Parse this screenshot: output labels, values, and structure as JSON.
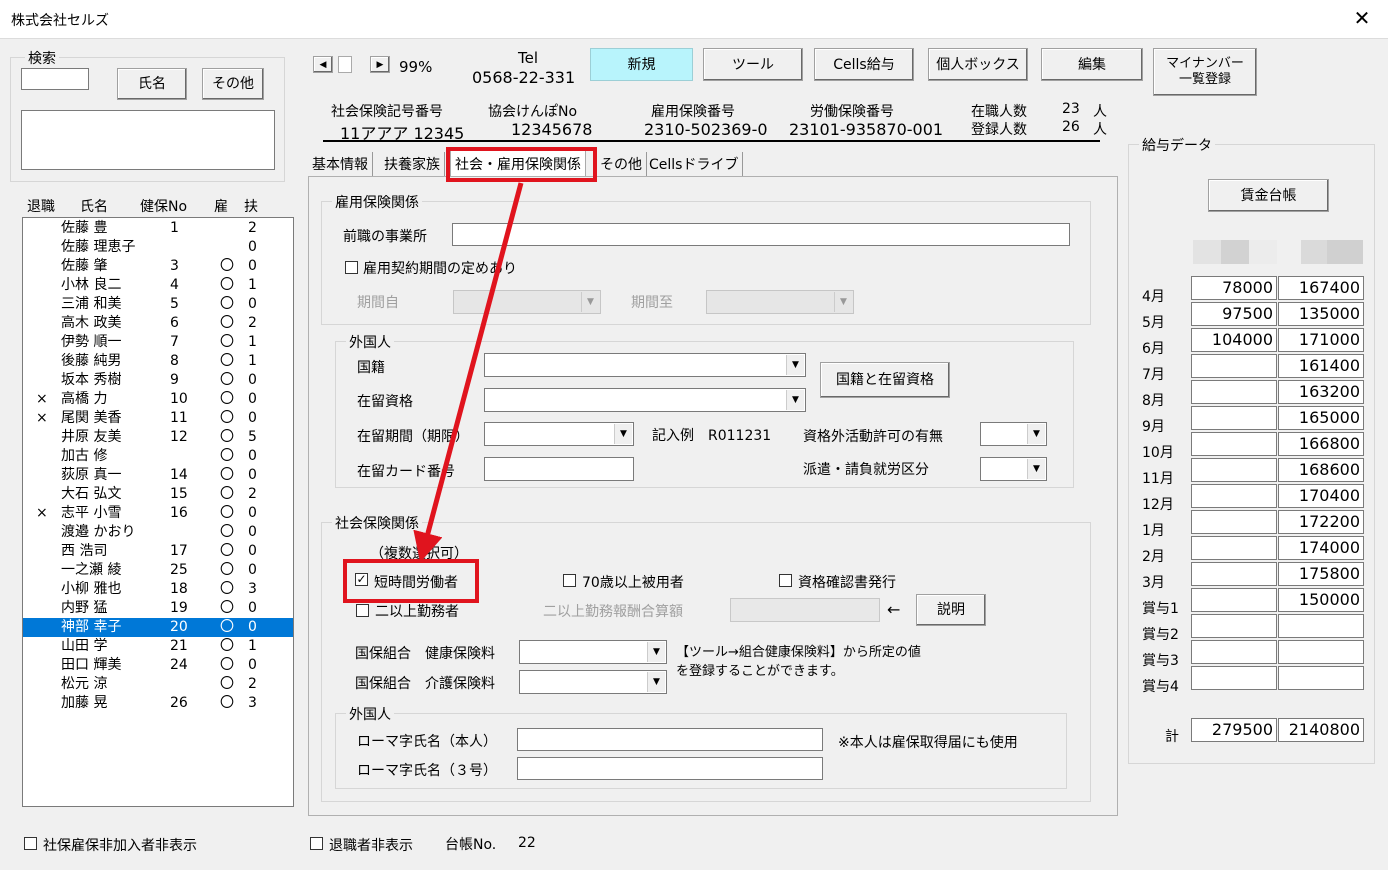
{
  "window": {
    "title": "株式会社セルズ",
    "close": "✕"
  },
  "search": {
    "legend": "検索",
    "name_btn": "氏名",
    "other_btn": "その他",
    "input_value": ""
  },
  "list": {
    "headers": {
      "retired": "退職",
      "name": "氏名",
      "kenpo": "健保No",
      "koyo": "雇",
      "fuyo": "扶"
    },
    "rows": [
      {
        "mark": "",
        "name": "佐藤 豊",
        "no": "1",
        "koyo": "",
        "fuyo": "2"
      },
      {
        "mark": "",
        "name": "佐藤 理恵子",
        "no": "",
        "koyo": "",
        "fuyo": "0"
      },
      {
        "mark": "",
        "name": "佐藤 肇",
        "no": "3",
        "koyo": "〇",
        "fuyo": "0"
      },
      {
        "mark": "",
        "name": "小林 良二",
        "no": "4",
        "koyo": "〇",
        "fuyo": "1"
      },
      {
        "mark": "",
        "name": "三浦 和美",
        "no": "5",
        "koyo": "〇",
        "fuyo": "0"
      },
      {
        "mark": "",
        "name": "高木 政美",
        "no": "6",
        "koyo": "〇",
        "fuyo": "2"
      },
      {
        "mark": "",
        "name": "伊勢 順一",
        "no": "7",
        "koyo": "〇",
        "fuyo": "1"
      },
      {
        "mark": "",
        "name": "後藤 純男",
        "no": "8",
        "koyo": "〇",
        "fuyo": "1"
      },
      {
        "mark": "",
        "name": "坂本 秀樹",
        "no": "9",
        "koyo": "〇",
        "fuyo": "0"
      },
      {
        "mark": "×",
        "name": "高橋 力",
        "no": "10",
        "koyo": "〇",
        "fuyo": "0"
      },
      {
        "mark": "×",
        "name": "尾関 美香",
        "no": "11",
        "koyo": "〇",
        "fuyo": "0"
      },
      {
        "mark": "",
        "name": "井原 友美",
        "no": "12",
        "koyo": "〇",
        "fuyo": "5"
      },
      {
        "mark": "",
        "name": "加古 修",
        "no": "",
        "koyo": "〇",
        "fuyo": "0"
      },
      {
        "mark": "",
        "name": "荻原 真一",
        "no": "14",
        "koyo": "〇",
        "fuyo": "0"
      },
      {
        "mark": "",
        "name": "大石 弘文",
        "no": "15",
        "koyo": "〇",
        "fuyo": "2"
      },
      {
        "mark": "×",
        "name": "志平 小雪",
        "no": "16",
        "koyo": "〇",
        "fuyo": "0"
      },
      {
        "mark": "",
        "name": "渡邉 かおり",
        "no": "",
        "koyo": "〇",
        "fuyo": "0"
      },
      {
        "mark": "",
        "name": "西 浩司",
        "no": "17",
        "koyo": "〇",
        "fuyo": "0"
      },
      {
        "mark": "",
        "name": "一之瀬 綾",
        "no": "25",
        "koyo": "〇",
        "fuyo": "0"
      },
      {
        "mark": "",
        "name": "小柳 雅也",
        "no": "18",
        "koyo": "〇",
        "fuyo": "3"
      },
      {
        "mark": "",
        "name": "内野 猛",
        "no": "19",
        "koyo": "〇",
        "fuyo": "0"
      },
      {
        "mark": "",
        "name": "神部 幸子",
        "no": "20",
        "koyo": "〇",
        "fuyo": "0",
        "selected": true
      },
      {
        "mark": "",
        "name": "山田 学",
        "no": "21",
        "koyo": "〇",
        "fuyo": "1"
      },
      {
        "mark": "",
        "name": "田口 輝美",
        "no": "24",
        "koyo": "〇",
        "fuyo": "0"
      },
      {
        "mark": "",
        "name": "松元 涼",
        "no": "",
        "koyo": "〇",
        "fuyo": "2"
      },
      {
        "mark": "",
        "name": "加藤 晃",
        "no": "26",
        "koyo": "〇",
        "fuyo": "3"
      }
    ]
  },
  "bottom": {
    "hide_uninsured": "社保雇保非加入者非表示",
    "hide_retired": "退職者非表示",
    "ledger_label": "台帳No.",
    "ledger_no": "22"
  },
  "nav": {
    "zoom": "99%",
    "tel_label": "Tel",
    "tel": "0568-22-331"
  },
  "toolbar": {
    "new": "新規",
    "tool": "ツール",
    "cells_salary": "Cells給与",
    "personal_box": "個人ボックス",
    "edit": "編集",
    "mynumber_1": "マイナンバー",
    "mynumber_2": "一覧登録"
  },
  "info": {
    "social_label": "社会保険記号番号",
    "social_value": "11アアア 12345",
    "kyokai_label": "協会けんぽNo",
    "kyokai_value": "12345678",
    "koyo_label": "雇用保険番号",
    "koyo_value": "2310-502369-0",
    "rodo_label": "労働保険番号",
    "rodo_value": "23101-935870-001",
    "employed_label": "在職人数",
    "employed_value": "23",
    "employed_unit": "人",
    "registered_label": "登録人数",
    "registered_value": "26",
    "registered_unit": "人"
  },
  "tabs": {
    "basic": "基本情報",
    "dependents": "扶養家族",
    "insurance": "社会・雇用保険関係",
    "other": "その他",
    "drive": "Cellsドライブ"
  },
  "employment": {
    "legend": "雇用保険関係",
    "prev_office": "前職の事業所",
    "prev_office_value": "",
    "contract_period": "雇用契約期間の定めあり",
    "from": "期間自",
    "to": "期間至"
  },
  "foreign1": {
    "legend": "外国人",
    "nationality": "国籍",
    "status": "在留資格",
    "period": "在留期間（期限）",
    "card": "在留カード番号",
    "example": "記入例　R011231",
    "work_permit": "資格外活動許可の有無",
    "dispatch": "派遣・請負就労区分",
    "nat_btn": "国籍と在留資格"
  },
  "social": {
    "legend": "社会保険関係",
    "multi": "（複数選択可）",
    "short_time": "短時間労働者",
    "over70": "70歳以上被用者",
    "cert": "資格確認書発行",
    "two_offices": "二以上勤務者",
    "two_offices_total": "二以上勤務報酬合算額",
    "arrow": "←",
    "explain_btn": "説明",
    "health": "国保組合　健康保険料",
    "care": "国保組合　介護保険料",
    "note_1": "【ツール→組合健康保険料】から所定の値",
    "note_2": "を登録することができます。"
  },
  "foreign2": {
    "legend": "外国人",
    "roman_self": "ローマ字氏名（本人）",
    "roman_3": "ローマ字氏名（３号）",
    "note": "※本人は雇保取得届にも使用"
  },
  "salary": {
    "legend": "給与データ",
    "ledger_btn": "賃金台帳",
    "rows": [
      {
        "label": "4月",
        "a": "78000",
        "b": "167400"
      },
      {
        "label": "5月",
        "a": "97500",
        "b": "135000"
      },
      {
        "label": "6月",
        "a": "104000",
        "b": "171000"
      },
      {
        "label": "7月",
        "a": "",
        "b": "161400"
      },
      {
        "label": "8月",
        "a": "",
        "b": "163200"
      },
      {
        "label": "9月",
        "a": "",
        "b": "165000"
      },
      {
        "label": "10月",
        "a": "",
        "b": "166800"
      },
      {
        "label": "11月",
        "a": "",
        "b": "168600"
      },
      {
        "label": "12月",
        "a": "",
        "b": "170400"
      },
      {
        "label": "1月",
        "a": "",
        "b": "172200"
      },
      {
        "label": "2月",
        "a": "",
        "b": "174000"
      },
      {
        "label": "3月",
        "a": "",
        "b": "175800"
      },
      {
        "label": "賞与1",
        "a": "",
        "b": "150000"
      },
      {
        "label": "賞与2",
        "a": "",
        "b": ""
      },
      {
        "label": "賞与3",
        "a": "",
        "b": ""
      },
      {
        "label": "賞与4",
        "a": "",
        "b": ""
      }
    ],
    "total_label": "計",
    "total_a": "279500",
    "total_b": "2140800"
  },
  "colors": {
    "highlight_red": "#e0141e",
    "selected_row": "#0078d7",
    "new_button": "#b8f4fc"
  }
}
